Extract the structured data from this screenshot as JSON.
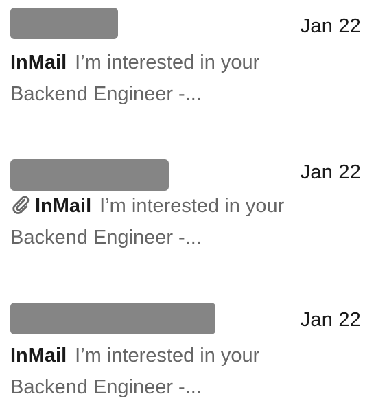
{
  "conversations": [
    {
      "sender": "",
      "date": "Jan 22",
      "badge": "InMail",
      "has_attachment": false,
      "preview": "I’m interested in your Backend Engineer -..."
    },
    {
      "sender": "",
      "date": "Jan 22",
      "badge": "InMail",
      "has_attachment": true,
      "preview": "I’m interested in your Backend Engineer -..."
    },
    {
      "sender": "",
      "date": "Jan 22",
      "badge": "InMail",
      "has_attachment": false,
      "preview": "I’m interested in your Backend Engineer -..."
    }
  ],
  "icons": {
    "attachment": "paperclip-icon"
  },
  "colors": {
    "redaction": "#858585",
    "preview_text": "#666666",
    "primary_text": "#1a1a1a",
    "divider": "#e3e3e3"
  }
}
